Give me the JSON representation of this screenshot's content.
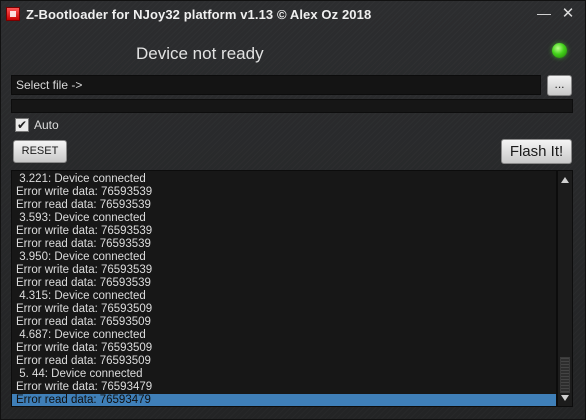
{
  "window": {
    "title": "Z-Bootloader for NJoy32 platform v1.13 © Alex Oz 2018",
    "minimize_glyph": "—",
    "close_glyph": "✕",
    "icon": "app-icon"
  },
  "status": {
    "text": "Device not ready",
    "indicator_color": "#3fd11a"
  },
  "file": {
    "label": "Select file ->",
    "browse_label": "..."
  },
  "progress": {
    "value_percent": 0
  },
  "auto": {
    "label": "Auto",
    "checked": true,
    "check_glyph": "✔"
  },
  "buttons": {
    "reset": "RESET",
    "flash": "Flash It!"
  },
  "log": {
    "selected_index": 18,
    "selection_color": "#3f7fb8",
    "lines": [
      " 3.221: Device connected",
      "Error write data: 76593539",
      "Error read data: 76593539",
      " 3.593: Device connected",
      "Error write data: 76593539",
      "Error read data: 76593539",
      " 3.950: Device connected",
      "Error write data: 76593539",
      "Error read data: 76593539",
      " 4.315: Device connected",
      "Error write data: 76593509",
      "Error read data: 76593509",
      " 4.687: Device connected",
      "Error write data: 76593509",
      "Error read data: 76593509",
      " 5. 44: Device connected",
      "Error write data: 76593479",
      "Error read data: 76593479"
    ]
  }
}
